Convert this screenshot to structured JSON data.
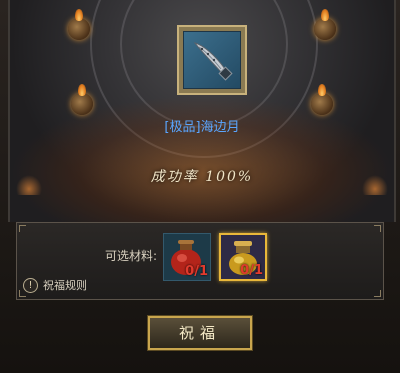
{
  "item": {
    "name": "[极品]海边月",
    "icon": "dagger-icon"
  },
  "success_rate": {
    "text": "成功率 100%"
  },
  "materials": {
    "label": "可选材料:",
    "items": [
      {
        "icon": "red-potion-icon",
        "count": "0/1",
        "selected": false
      },
      {
        "icon": "gold-potion-icon",
        "count": "0/1",
        "selected": true
      }
    ]
  },
  "rules_label": "祝福规则",
  "bless_button": "祝福",
  "colors": {
    "item_name": "#5aa6ff",
    "count": "#e13a2d",
    "accent_gold": "#c9a64e"
  }
}
